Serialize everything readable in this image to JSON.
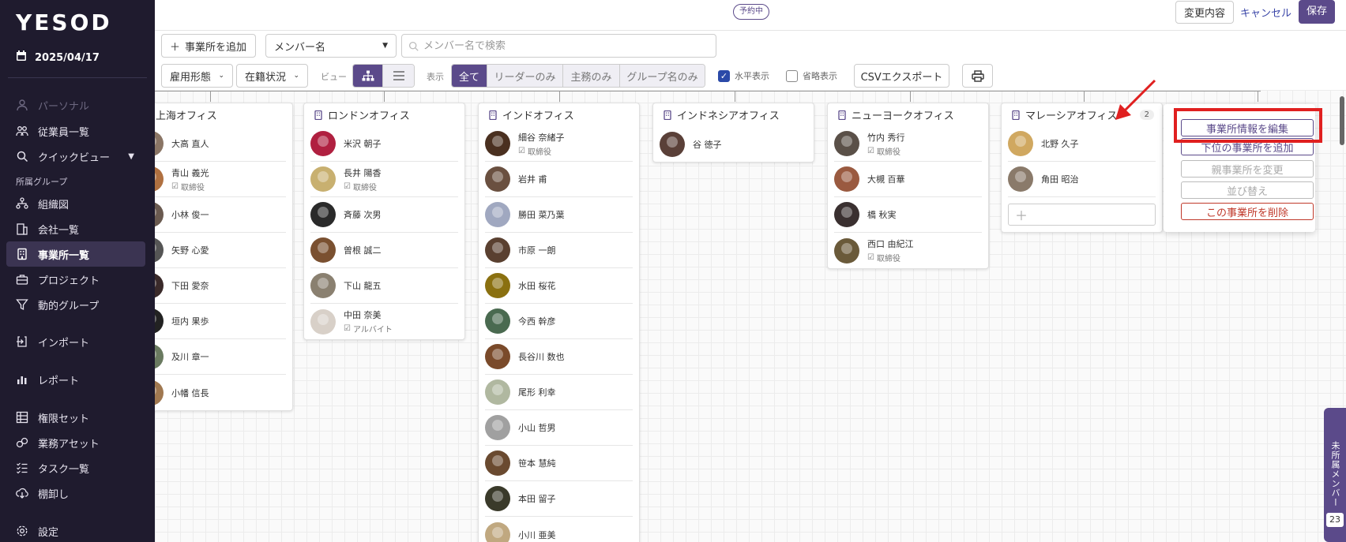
{
  "app": {
    "logo": "YESOD",
    "date": "2025/04/17"
  },
  "sidebar": {
    "items": [
      {
        "label": "パーソナル",
        "icon": "person-icon",
        "disabled": true
      },
      {
        "label": "従業員一覧",
        "icon": "users-icon"
      },
      {
        "label": "クイックビュー",
        "icon": "search-icon"
      },
      {
        "label": "組織図",
        "icon": "org-chart-icon"
      },
      {
        "label": "会社一覧",
        "icon": "company-icon"
      },
      {
        "label": "事業所一覧",
        "icon": "building-icon",
        "active": true
      },
      {
        "label": "プロジェクト",
        "icon": "briefcase-icon"
      },
      {
        "label": "動的グループ",
        "icon": "filter-icon"
      },
      {
        "label": "インポート",
        "icon": "import-icon"
      },
      {
        "label": "レポート",
        "icon": "report-icon"
      },
      {
        "label": "権限セット",
        "icon": "grid-icon"
      },
      {
        "label": "業務アセット",
        "icon": "link-icon"
      },
      {
        "label": "タスク一覧",
        "icon": "checklist-icon"
      },
      {
        "label": "棚卸し",
        "icon": "download-icon"
      },
      {
        "label": "設定",
        "icon": "gear-icon"
      }
    ],
    "section_label": "所属グループ"
  },
  "topbar": {
    "status": "予約中",
    "changes": "変更内容",
    "cancel": "キャンセル",
    "save": "保存"
  },
  "toolbar": {
    "add_office": "事業所を追加",
    "member_select": "メンバー名",
    "search_placeholder": "メンバー名で検索",
    "employment_type": "雇用形態",
    "status": "在籍状況",
    "view_label": "ビュー",
    "display_label": "表示",
    "display_options": [
      "全て",
      "リーダーのみ",
      "主務のみ",
      "グループ名のみ"
    ],
    "horizontal": "水平表示",
    "compact": "省略表示",
    "csv": "CSVエクスポート"
  },
  "offices": [
    {
      "name": "上海オフィス",
      "members": [
        {
          "name": "大高 直人"
        },
        {
          "name": "青山 義光",
          "role": "取締役"
        },
        {
          "name": "小林 俊一"
        },
        {
          "name": "矢野 心愛"
        },
        {
          "name": "下田 愛奈"
        },
        {
          "name": "垣内 果歩"
        },
        {
          "name": "及川 章一"
        },
        {
          "name": "小幡 信長"
        }
      ]
    },
    {
      "name": "ロンドンオフィス",
      "members": [
        {
          "name": "米沢 朝子"
        },
        {
          "name": "長井 陽香",
          "role": "取締役"
        },
        {
          "name": "斉藤 次男"
        },
        {
          "name": "曽根 誠二"
        },
        {
          "name": "下山 龍五"
        },
        {
          "name": "中田 奈美",
          "role": "アルバイト"
        }
      ]
    },
    {
      "name": "インドオフィス",
      "members": [
        {
          "name": "細谷 奈緒子",
          "role": "取締役"
        },
        {
          "name": "岩井 甫"
        },
        {
          "name": "勝田 菜乃葉"
        },
        {
          "name": "市原 一朗"
        },
        {
          "name": "水田 桜花"
        },
        {
          "name": "今西 幹彦"
        },
        {
          "name": "長谷川 数也"
        },
        {
          "name": "尾形 利幸"
        },
        {
          "name": "小山 哲男"
        },
        {
          "name": "笹本 慧純"
        },
        {
          "name": "本田 留子"
        },
        {
          "name": "小川 亜美"
        }
      ]
    },
    {
      "name": "インドネシアオフィス",
      "members": [
        {
          "name": "谷 徳子"
        }
      ]
    },
    {
      "name": "ニューヨークオフィス",
      "members": [
        {
          "name": "竹内 秀行",
          "role": "取締役"
        },
        {
          "name": "大槻 百華"
        },
        {
          "name": "橋 秋実"
        },
        {
          "name": "西口 由紀江",
          "role": "取締役"
        }
      ]
    },
    {
      "name": "マレーシアオフィス",
      "count": "2",
      "members": [
        {
          "name": "北野 久子"
        },
        {
          "name": "角田 昭治"
        }
      ]
    }
  ],
  "context_menu": {
    "items": [
      {
        "label": "事業所情報を編集"
      },
      {
        "label": "下位の事業所を追加"
      },
      {
        "label": "親事業所を変更",
        "disabled": true
      },
      {
        "label": "並び替え",
        "disabled": true
      },
      {
        "label": "この事業所を削除",
        "danger": true
      }
    ]
  },
  "unassigned": {
    "label": "未所属メンバー",
    "count": "23"
  },
  "colors": {
    "accent": "#5b4a8a",
    "sidebar_bg": "#1f1b2e",
    "danger": "#c0392b",
    "highlight": "#e02020"
  }
}
